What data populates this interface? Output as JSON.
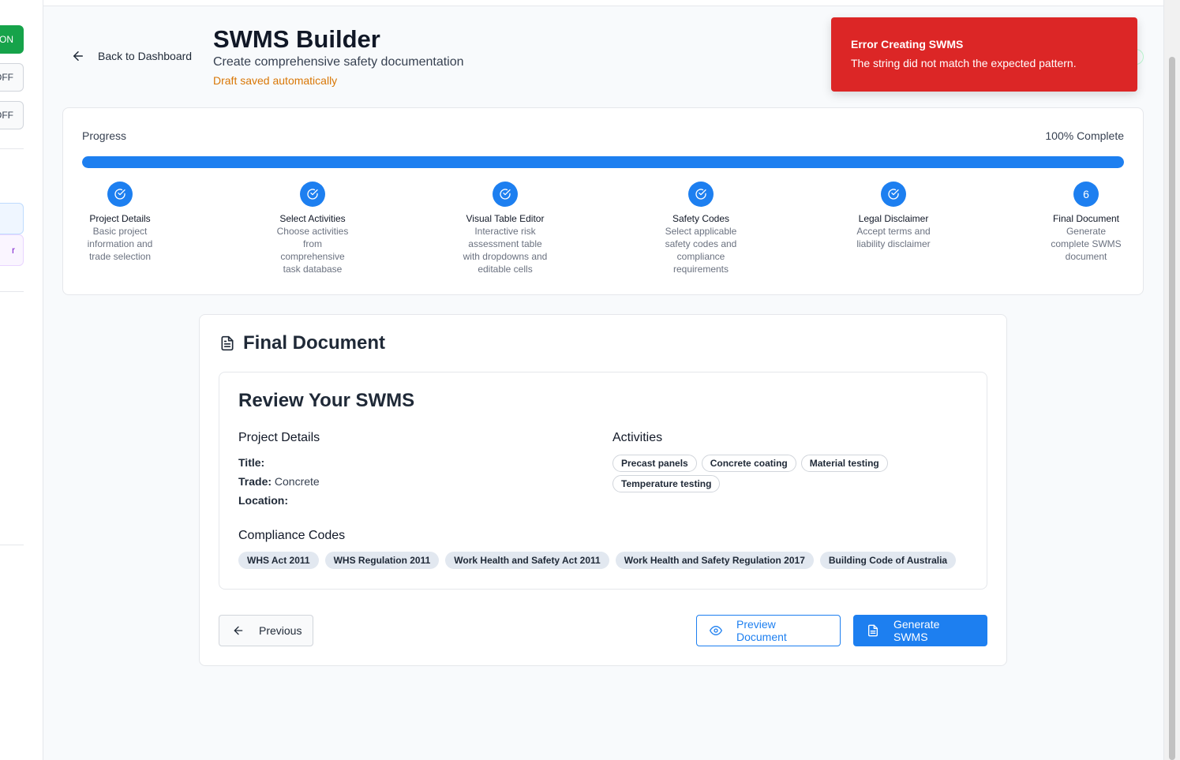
{
  "sidebar": {
    "toggle_on": "ON",
    "toggle_off_1": "OFF",
    "toggle_off_2": "OFF",
    "card_label": "r"
  },
  "header": {
    "back_label": "Back to Dashboard",
    "title": "SWMS Builder",
    "subtitle": "Create comprehensive safety documentation",
    "draft_status": "Draft saved automatically"
  },
  "toast": {
    "title": "Error Creating SWMS",
    "message": "The string did not match the expected pattern."
  },
  "progress": {
    "label": "Progress",
    "percent_label": "100% Complete",
    "percent": 100,
    "steps": [
      {
        "title": "Project Details",
        "desc": "Basic project information and trade selection",
        "completed": true
      },
      {
        "title": "Select Activities",
        "desc": "Choose activities from comprehensive task database",
        "completed": true
      },
      {
        "title": "Visual Table Editor",
        "desc": "Interactive risk assessment table with dropdowns and editable cells",
        "completed": true
      },
      {
        "title": "Safety Codes",
        "desc": "Select applicable safety codes and compliance requirements",
        "completed": true
      },
      {
        "title": "Legal Disclaimer",
        "desc": "Accept terms and liability disclaimer",
        "completed": true
      },
      {
        "title": "Final Document",
        "desc": "Generate complete SWMS document",
        "number": "6",
        "completed": false
      }
    ]
  },
  "final": {
    "heading": "Final Document",
    "review_title": "Review Your SWMS",
    "project_heading": "Project Details",
    "title_label": "Title:",
    "title_value": "",
    "trade_label": "Trade:",
    "trade_value": "Concrete",
    "location_label": "Location:",
    "location_value": "",
    "activities_heading": "Activities",
    "activities": [
      "Precast panels",
      "Concrete coating",
      "Material testing",
      "Temperature testing"
    ],
    "compliance_heading": "Compliance Codes",
    "codes": [
      "WHS Act 2011",
      "WHS Regulation 2011",
      "Work Health and Safety Act 2011",
      "Work Health and Safety Regulation 2017",
      "Building Code of Australia"
    ]
  },
  "buttons": {
    "previous": "Previous",
    "preview": "Preview Document",
    "generate": "Generate SWMS"
  },
  "colors": {
    "primary": "#1d7ff0",
    "error": "#dc2626",
    "success": "#16a34a",
    "draft": "#d97706"
  }
}
